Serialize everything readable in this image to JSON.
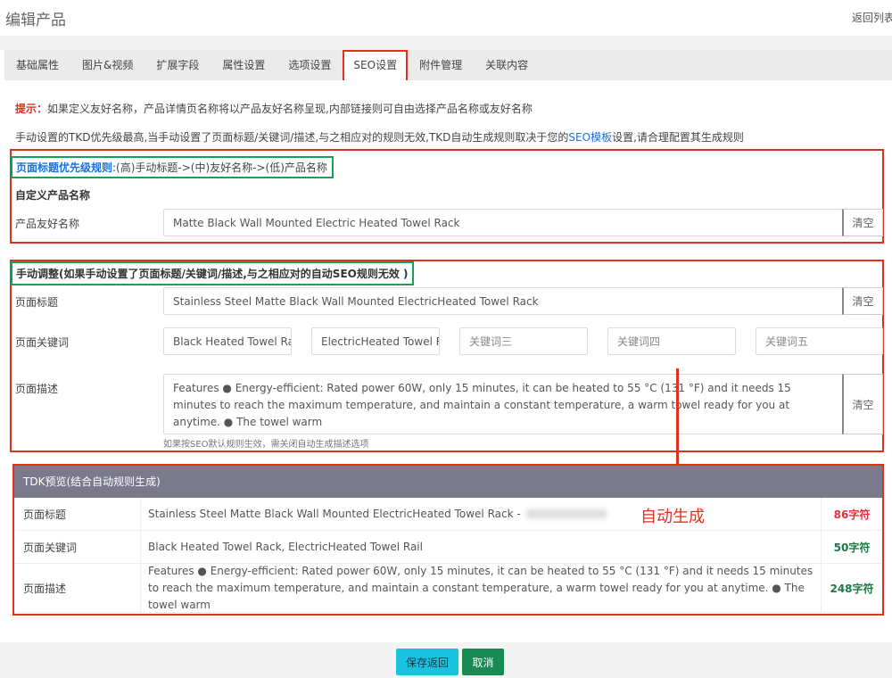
{
  "header": {
    "title": "编辑产品",
    "back_link": "返回列表"
  },
  "tabs": [
    {
      "label": "基础属性"
    },
    {
      "label": "图片&视频"
    },
    {
      "label": "扩展字段"
    },
    {
      "label": "属性设置"
    },
    {
      "label": "选项设置"
    },
    {
      "label": "SEO设置",
      "active": true
    },
    {
      "label": "附件管理"
    },
    {
      "label": "关联内容"
    }
  ],
  "hints": {
    "tip_label": "提示：",
    "tip_text": "如果定义友好名称，产品详情页名称将以产品友好名称呈现,内部链接则可自由选择产品名称或友好名称",
    "line2_pre": "手动设置的TKD优先级最高,当手动设置了页面标题/关键词/描述,与之相应对的规则无效,TKD自动生成规则取决于您的",
    "line2_link": "SEO模板",
    "line2_post": "设置,请合理配置其生成规则"
  },
  "priority": {
    "label": "页面标题优先级规则",
    "text": ":(高)手动标题->(中)友好名称->(低)产品名称"
  },
  "custom_name": {
    "heading": "自定义产品名称",
    "label": "产品友好名称",
    "value": "Matte Black Wall Mounted Electric Heated Towel Rack",
    "clear": "清空"
  },
  "manual": {
    "heading": "手动调整(如果手动设置了页面标题/关键词/描述,与之相应对的自动SEO规则无效 )",
    "title_label": "页面标题",
    "title_value": "Stainless Steel Matte Black Wall Mounted ElectricHeated Towel Rack",
    "title_clear": "清空",
    "keywords_label": "页面关键词",
    "keywords": [
      {
        "value": "Black Heated Towel Rack",
        "placeholder": "关键词一"
      },
      {
        "value": "ElectricHeated Towel Rail",
        "placeholder": "关键词二"
      },
      {
        "value": "",
        "placeholder": "关键词三"
      },
      {
        "value": "",
        "placeholder": "关键词四"
      },
      {
        "value": "",
        "placeholder": "关键词五"
      }
    ],
    "desc_label": "页面描述",
    "desc_value": "Features ● Energy-efficient: Rated power 60W, only 15 minutes, it can be heated to 55 °C (131 °F) and it needs 15 minutes to reach the maximum temperature, and maintain a constant temperature, a warm towel ready for you at anytime. ● The towel warm",
    "desc_clear": "清空",
    "desc_hint": "如果按SEO默认规则生效，需关闭自动生成描述选项"
  },
  "annotation": "自动生成",
  "preview": {
    "heading": "TDK预览(结合自动规则生成)",
    "rows": [
      {
        "label": "页面标题",
        "value": "Stainless Steel Matte Black Wall Mounted ElectricHeated Towel Rack -",
        "count": "86字符",
        "color": "#e0303a"
      },
      {
        "label": "页面关键词",
        "value": "Black Heated Towel Rack, ElectricHeated Towel Rail",
        "count": "50字符",
        "color": "#1a7a40"
      },
      {
        "label": "页面描述",
        "value": "Features ● Energy-efficient: Rated power 60W, only 15 minutes, it can be heated to 55 °C (131 °F) and it needs 15 minutes to reach the maximum temperature, and maintain a constant temperature, a warm towel ready for you at anytime. ● The towel warm",
        "count": "248字符",
        "color": "#1a7a40"
      }
    ]
  },
  "footer": {
    "save": "保存返回",
    "cancel": "取消"
  },
  "colors": {
    "highlight_red": "#e0301e",
    "highlight_green": "#1aa053",
    "save": "#19c3e0",
    "cancel": "#1a8a55",
    "link": "#1a6fe0"
  }
}
